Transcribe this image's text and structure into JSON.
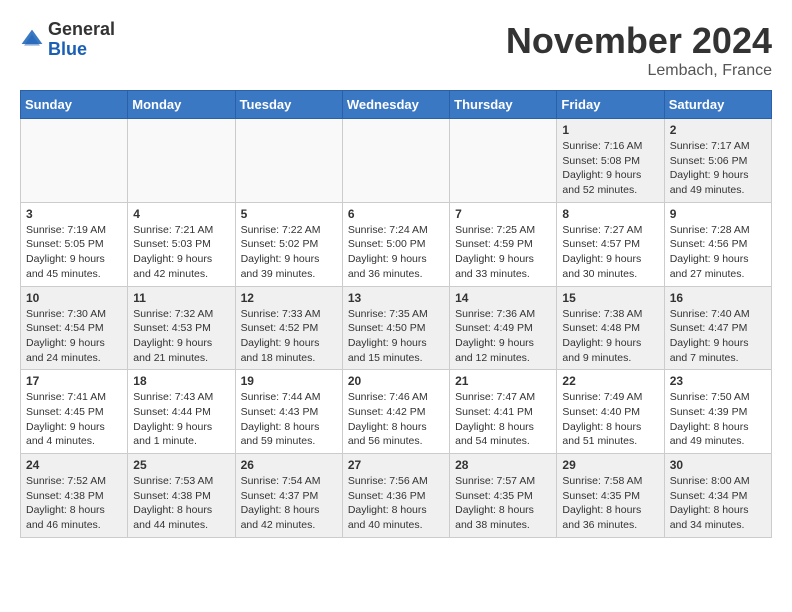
{
  "header": {
    "logo_general": "General",
    "logo_blue": "Blue",
    "month": "November 2024",
    "location": "Lembach, France"
  },
  "days_of_week": [
    "Sunday",
    "Monday",
    "Tuesday",
    "Wednesday",
    "Thursday",
    "Friday",
    "Saturday"
  ],
  "weeks": [
    [
      {
        "day": "",
        "info": "",
        "empty": true
      },
      {
        "day": "",
        "info": "",
        "empty": true
      },
      {
        "day": "",
        "info": "",
        "empty": true
      },
      {
        "day": "",
        "info": "",
        "empty": true
      },
      {
        "day": "",
        "info": "",
        "empty": true
      },
      {
        "day": "1",
        "info": "Sunrise: 7:16 AM\nSunset: 5:08 PM\nDaylight: 9 hours\nand 52 minutes."
      },
      {
        "day": "2",
        "info": "Sunrise: 7:17 AM\nSunset: 5:06 PM\nDaylight: 9 hours\nand 49 minutes."
      }
    ],
    [
      {
        "day": "3",
        "info": "Sunrise: 7:19 AM\nSunset: 5:05 PM\nDaylight: 9 hours\nand 45 minutes."
      },
      {
        "day": "4",
        "info": "Sunrise: 7:21 AM\nSunset: 5:03 PM\nDaylight: 9 hours\nand 42 minutes."
      },
      {
        "day": "5",
        "info": "Sunrise: 7:22 AM\nSunset: 5:02 PM\nDaylight: 9 hours\nand 39 minutes."
      },
      {
        "day": "6",
        "info": "Sunrise: 7:24 AM\nSunset: 5:00 PM\nDaylight: 9 hours\nand 36 minutes."
      },
      {
        "day": "7",
        "info": "Sunrise: 7:25 AM\nSunset: 4:59 PM\nDaylight: 9 hours\nand 33 minutes."
      },
      {
        "day": "8",
        "info": "Sunrise: 7:27 AM\nSunset: 4:57 PM\nDaylight: 9 hours\nand 30 minutes."
      },
      {
        "day": "9",
        "info": "Sunrise: 7:28 AM\nSunset: 4:56 PM\nDaylight: 9 hours\nand 27 minutes."
      }
    ],
    [
      {
        "day": "10",
        "info": "Sunrise: 7:30 AM\nSunset: 4:54 PM\nDaylight: 9 hours\nand 24 minutes."
      },
      {
        "day": "11",
        "info": "Sunrise: 7:32 AM\nSunset: 4:53 PM\nDaylight: 9 hours\nand 21 minutes."
      },
      {
        "day": "12",
        "info": "Sunrise: 7:33 AM\nSunset: 4:52 PM\nDaylight: 9 hours\nand 18 minutes."
      },
      {
        "day": "13",
        "info": "Sunrise: 7:35 AM\nSunset: 4:50 PM\nDaylight: 9 hours\nand 15 minutes."
      },
      {
        "day": "14",
        "info": "Sunrise: 7:36 AM\nSunset: 4:49 PM\nDaylight: 9 hours\nand 12 minutes."
      },
      {
        "day": "15",
        "info": "Sunrise: 7:38 AM\nSunset: 4:48 PM\nDaylight: 9 hours\nand 9 minutes."
      },
      {
        "day": "16",
        "info": "Sunrise: 7:40 AM\nSunset: 4:47 PM\nDaylight: 9 hours\nand 7 minutes."
      }
    ],
    [
      {
        "day": "17",
        "info": "Sunrise: 7:41 AM\nSunset: 4:45 PM\nDaylight: 9 hours\nand 4 minutes."
      },
      {
        "day": "18",
        "info": "Sunrise: 7:43 AM\nSunset: 4:44 PM\nDaylight: 9 hours\nand 1 minute."
      },
      {
        "day": "19",
        "info": "Sunrise: 7:44 AM\nSunset: 4:43 PM\nDaylight: 8 hours\nand 59 minutes."
      },
      {
        "day": "20",
        "info": "Sunrise: 7:46 AM\nSunset: 4:42 PM\nDaylight: 8 hours\nand 56 minutes."
      },
      {
        "day": "21",
        "info": "Sunrise: 7:47 AM\nSunset: 4:41 PM\nDaylight: 8 hours\nand 54 minutes."
      },
      {
        "day": "22",
        "info": "Sunrise: 7:49 AM\nSunset: 4:40 PM\nDaylight: 8 hours\nand 51 minutes."
      },
      {
        "day": "23",
        "info": "Sunrise: 7:50 AM\nSunset: 4:39 PM\nDaylight: 8 hours\nand 49 minutes."
      }
    ],
    [
      {
        "day": "24",
        "info": "Sunrise: 7:52 AM\nSunset: 4:38 PM\nDaylight: 8 hours\nand 46 minutes."
      },
      {
        "day": "25",
        "info": "Sunrise: 7:53 AM\nSunset: 4:38 PM\nDaylight: 8 hours\nand 44 minutes."
      },
      {
        "day": "26",
        "info": "Sunrise: 7:54 AM\nSunset: 4:37 PM\nDaylight: 8 hours\nand 42 minutes."
      },
      {
        "day": "27",
        "info": "Sunrise: 7:56 AM\nSunset: 4:36 PM\nDaylight: 8 hours\nand 40 minutes."
      },
      {
        "day": "28",
        "info": "Sunrise: 7:57 AM\nSunset: 4:35 PM\nDaylight: 8 hours\nand 38 minutes."
      },
      {
        "day": "29",
        "info": "Sunrise: 7:58 AM\nSunset: 4:35 PM\nDaylight: 8 hours\nand 36 minutes."
      },
      {
        "day": "30",
        "info": "Sunrise: 8:00 AM\nSunset: 4:34 PM\nDaylight: 8 hours\nand 34 minutes."
      }
    ]
  ]
}
